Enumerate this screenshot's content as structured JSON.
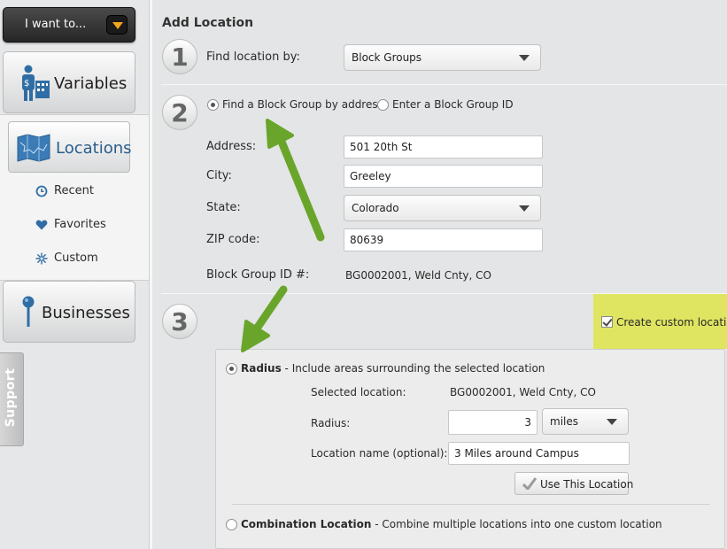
{
  "nav": {
    "i_want_to": "I want to...",
    "variables": "Variables",
    "locations": "Locations",
    "sub_items": [
      "Recent",
      "Favorites",
      "Custom"
    ],
    "businesses": "Businesses",
    "support": "Support"
  },
  "main": {
    "title": "Add Location",
    "step1": {
      "number": "1",
      "label": "Find location by:",
      "select_value": "Block Groups"
    },
    "step2": {
      "number": "2",
      "radio_address": "Find a Block Group by address",
      "radio_id": "Enter a Block Group ID",
      "address_label": "Address:",
      "address_value": "501 20th St",
      "city_label": "City:",
      "city_value": "Greeley",
      "state_label": "State:",
      "state_value": "Colorado",
      "zip_label": "ZIP code:",
      "zip_value": "80639",
      "bgid_label": "Block Group ID #:",
      "bgid_value": "BG0002001, Weld Cnty, CO"
    },
    "step3": {
      "number": "3",
      "custom_checkbox": "Create custom location",
      "radius_title": "Radius",
      "radius_desc": " - Include areas surrounding the selected location",
      "selected_label": "Selected location:",
      "selected_value": "BG0002001, Weld Cnty, CO",
      "radius_label": "Radius:",
      "radius_value": "3",
      "radius_unit": "miles",
      "name_label": "Location name (optional):",
      "name_value": "3 Miles around Campus",
      "use_button": "Use This Location",
      "combo_title": "Combination Location",
      "combo_desc": " - Combine multiple locations into one custom location"
    }
  },
  "colors": {
    "highlight": "#dfe561",
    "arrow": "#6aa52b",
    "nav_active_text": "#2b5d8c",
    "icon_blue": "#2f6ea5"
  }
}
